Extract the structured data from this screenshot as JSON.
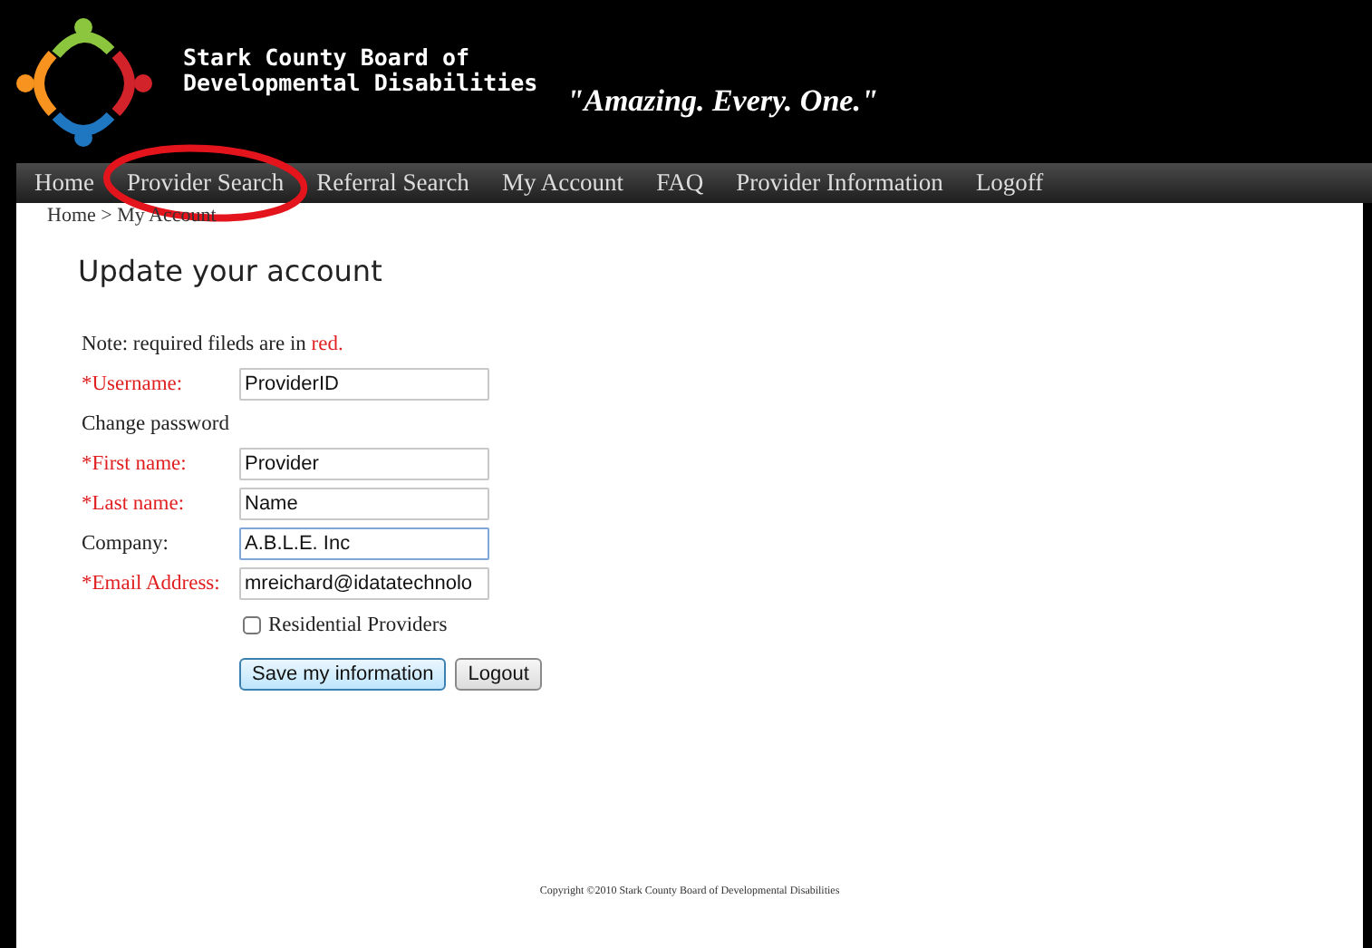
{
  "header": {
    "org_name_lines": [
      "Stark County Board of",
      "Developmental Disabilities"
    ],
    "tagline": "\"Amazing. Every. One.\""
  },
  "nav": [
    {
      "label": "Home",
      "circled": false
    },
    {
      "label": "Provider Search",
      "circled": true
    },
    {
      "label": "Referral Search",
      "circled": false
    },
    {
      "label": "My Account",
      "circled": false
    },
    {
      "label": "FAQ",
      "circled": false
    },
    {
      "label": "Provider Information",
      "circled": false
    },
    {
      "label": "Logoff",
      "circled": false
    }
  ],
  "breadcrumb": "Home > My Account",
  "title": "Update your account",
  "note": {
    "text": "Note: required fileds are in ",
    "highlight": "red."
  },
  "fields": [
    {
      "kind": "input",
      "label": "*Username:",
      "required": true,
      "value": "ProviderID",
      "focused": false
    },
    {
      "kind": "text",
      "label": "Change password"
    },
    {
      "kind": "input",
      "label": "*First name:",
      "required": true,
      "value": "Provider",
      "focused": false
    },
    {
      "kind": "input",
      "label": "*Last name:",
      "required": true,
      "value": "Name",
      "focused": false
    },
    {
      "kind": "input",
      "label": "Company:",
      "required": false,
      "value": "A.B.L.E. Inc",
      "focused": true
    },
    {
      "kind": "input",
      "label": "*Email Address:",
      "required": true,
      "value": "mreichard@idatatechnolo",
      "focused": false
    }
  ],
  "checkbox": {
    "label": "Residential Providers",
    "checked": false
  },
  "buttons": [
    {
      "label": "Save my information",
      "default": true
    },
    {
      "label": "Logout",
      "default": false
    }
  ],
  "footer": "Copyright ©2010 Stark County Board of Developmental Disabilities"
}
